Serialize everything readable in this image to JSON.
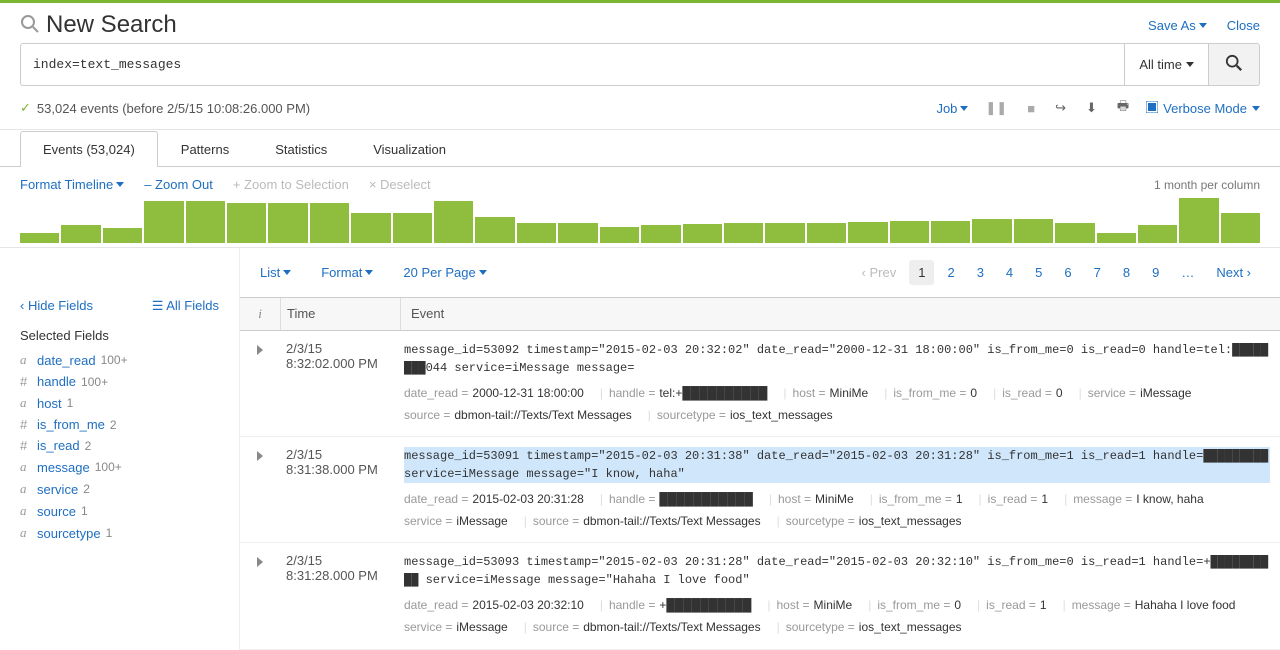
{
  "header": {
    "title": "New Search",
    "save_as": "Save As",
    "close": "Close"
  },
  "search": {
    "query": "index=text_messages",
    "time_picker": "All time",
    "status": "53,024 events (before 2/5/15 10:08:26.000 PM)",
    "job": "Job",
    "verbose_mode": "Verbose Mode"
  },
  "tabs": {
    "events": "Events (53,024)",
    "patterns": "Patterns",
    "statistics": "Statistics",
    "visualization": "Visualization"
  },
  "timeline_ctrls": {
    "format": "Format Timeline",
    "zoom_out": "– Zoom Out",
    "zoom_sel": "+ Zoom to Selection",
    "deselect": "× Deselect",
    "scale": "1 month per column"
  },
  "timeline_bars": [
    10,
    18,
    15,
    42,
    42,
    40,
    40,
    40,
    30,
    30,
    42,
    26,
    20,
    20,
    16,
    18,
    19,
    20,
    20,
    20,
    21,
    22,
    22,
    24,
    24,
    20,
    10,
    18,
    45,
    30
  ],
  "list_ctrls": {
    "list": "List",
    "format": "Format",
    "per_page": "20 Per Page"
  },
  "pager": {
    "prev": "‹ Prev",
    "pages": [
      "1",
      "2",
      "3",
      "4",
      "5",
      "6",
      "7",
      "8",
      "9",
      "…"
    ],
    "next": "Next ›"
  },
  "sidebar": {
    "hide": "‹ Hide Fields",
    "all": "All Fields",
    "selected_label": "Selected Fields",
    "fields": [
      {
        "type": "a",
        "name": "date_read",
        "count": "100+"
      },
      {
        "type": "#",
        "name": "handle",
        "count": "100+"
      },
      {
        "type": "a",
        "name": "host",
        "count": "1"
      },
      {
        "type": "#",
        "name": "is_from_me",
        "count": "2"
      },
      {
        "type": "#",
        "name": "is_read",
        "count": "2"
      },
      {
        "type": "a",
        "name": "message",
        "count": "100+"
      },
      {
        "type": "a",
        "name": "service",
        "count": "2"
      },
      {
        "type": "a",
        "name": "source",
        "count": "1"
      },
      {
        "type": "a",
        "name": "sourcetype",
        "count": "1"
      }
    ]
  },
  "event_header": {
    "i": "i",
    "time": "Time",
    "event": "Event"
  },
  "events": [
    {
      "date": "2/3/15",
      "time": "8:32:02.000 PM",
      "raw": "message_id=53092 timestamp=\"2015-02-03 20:32:02\" date_read=\"2000-12-31 18:00:00\" is_from_me=0 is_read=0 handle=tel:████████044 service=iMessage message=",
      "kv1": [
        {
          "k": "date_read =",
          "v": "2000-12-31 18:00:00"
        },
        {
          "k": "handle =",
          "v": "tel:+██████████"
        },
        {
          "k": "host =",
          "v": "MiniMe"
        },
        {
          "k": "is_from_me =",
          "v": "0"
        },
        {
          "k": "is_read =",
          "v": "0"
        },
        {
          "k": "service =",
          "v": "iMessage"
        }
      ],
      "kv2": [
        {
          "k": "source =",
          "v": "dbmon-tail://Texts/Text Messages"
        },
        {
          "k": "sourcetype =",
          "v": "ios_text_messages"
        }
      ],
      "hl": false
    },
    {
      "date": "2/3/15",
      "time": "8:31:38.000 PM",
      "raw": "message_id=53091 timestamp=\"2015-02-03 20:31:38\" date_read=\"2015-02-03 20:31:28\" is_from_me=1 is_read=1 handle=█████████ service=iMessage message=\"I know, haha\"",
      "kv1": [
        {
          "k": "date_read =",
          "v": "2015-02-03 20:31:28"
        },
        {
          "k": "handle =",
          "v": "███████████"
        },
        {
          "k": "host =",
          "v": "MiniMe"
        },
        {
          "k": "is_from_me =",
          "v": "1"
        },
        {
          "k": "is_read =",
          "v": "1"
        },
        {
          "k": "message =",
          "v": "I know, haha"
        }
      ],
      "kv2": [
        {
          "k": "service =",
          "v": "iMessage"
        },
        {
          "k": "source =",
          "v": "dbmon-tail://Texts/Text Messages"
        },
        {
          "k": "sourcetype =",
          "v": "ios_text_messages"
        }
      ],
      "hl": true
    },
    {
      "date": "2/3/15",
      "time": "8:31:28.000 PM",
      "raw": "message_id=53093 timestamp=\"2015-02-03 20:31:28\" date_read=\"2015-02-03 20:32:10\" is_from_me=0 is_read=1 handle=+██████████ service=iMessage message=\"Hahaha I love food\"",
      "kv1": [
        {
          "k": "date_read =",
          "v": "2015-02-03 20:32:10"
        },
        {
          "k": "handle =",
          "v": "+██████████"
        },
        {
          "k": "host =",
          "v": "MiniMe"
        },
        {
          "k": "is_from_me =",
          "v": "0"
        },
        {
          "k": "is_read =",
          "v": "1"
        },
        {
          "k": "message =",
          "v": "Hahaha I love food"
        }
      ],
      "kv2": [
        {
          "k": "service =",
          "v": "iMessage"
        },
        {
          "k": "source =",
          "v": "dbmon-tail://Texts/Text Messages"
        },
        {
          "k": "sourcetype =",
          "v": "ios_text_messages"
        }
      ],
      "hl": false
    }
  ]
}
